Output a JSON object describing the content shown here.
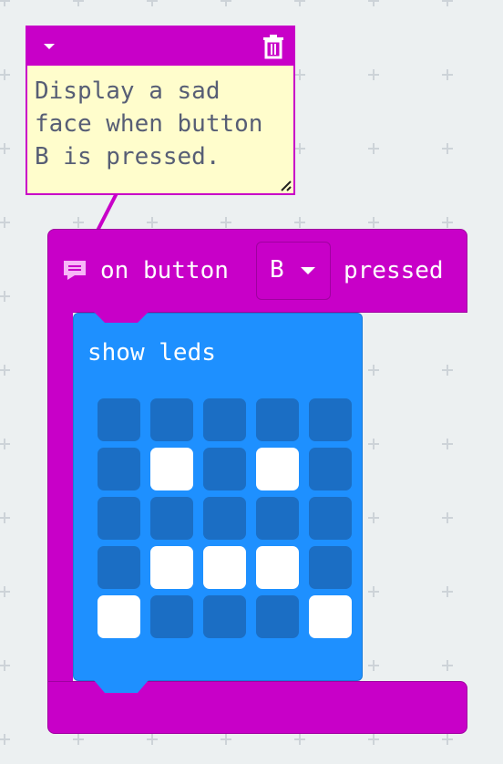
{
  "colors": {
    "workspace_bg": "#ecf0f1",
    "grid_plus": "#cdd3d8",
    "event_block": "#c800c8",
    "leds_block": "#1e90ff",
    "led_off": "#1b6ec4",
    "led_on": "#ffffff",
    "comment_bg": "#fffdcc",
    "comment_text": "#575e75"
  },
  "comment": {
    "text": "Display a sad\nface when button\nB is pressed.",
    "icons": [
      "collapse-triangle-icon",
      "trash-icon",
      "resize-handle-icon"
    ]
  },
  "event_block": {
    "icon": "comment-icon",
    "label_prefix": "on button",
    "button_value": "B",
    "label_suffix": "pressed"
  },
  "show_leds": {
    "label": "show leds",
    "leds": [
      [
        0,
        0,
        0,
        0,
        0
      ],
      [
        0,
        1,
        0,
        1,
        0
      ],
      [
        0,
        0,
        0,
        0,
        0
      ],
      [
        0,
        1,
        1,
        1,
        0
      ],
      [
        1,
        0,
        0,
        0,
        1
      ]
    ]
  }
}
